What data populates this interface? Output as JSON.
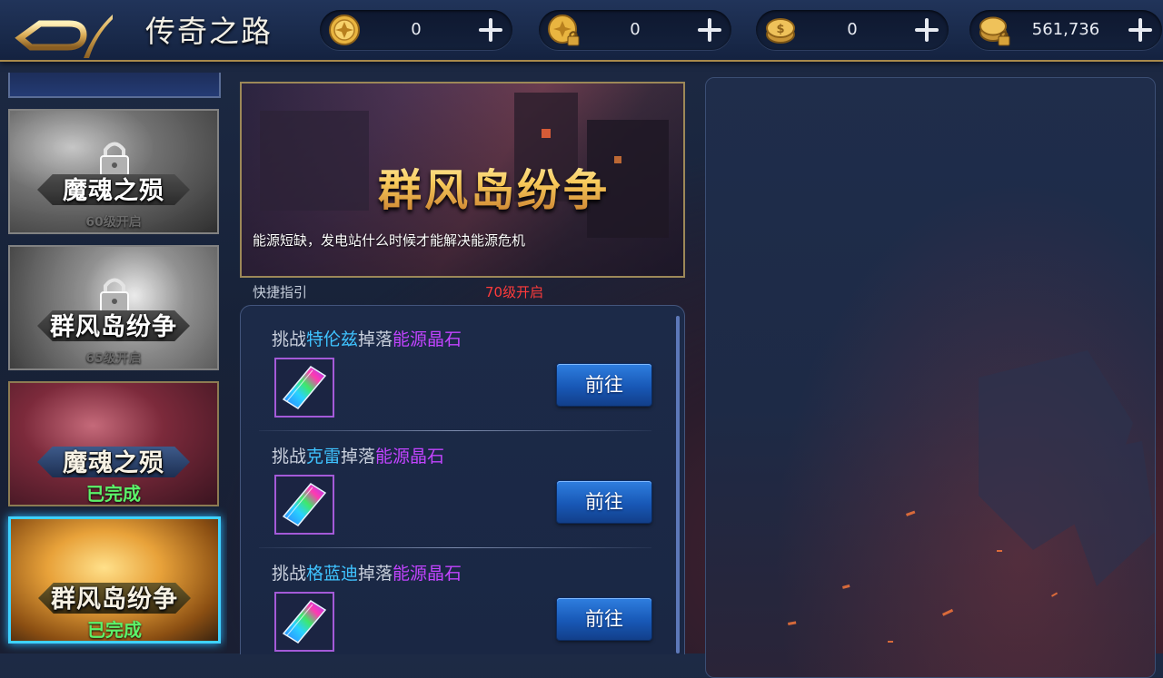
{
  "header": {
    "title": "传奇之路",
    "currencies": [
      {
        "icon": "gold-coin-icon",
        "amount": "0"
      },
      {
        "icon": "locked-gold-coin-icon",
        "amount": "0"
      },
      {
        "icon": "coin-stack-icon",
        "amount": "0"
      },
      {
        "icon": "locked-coin-stack-icon",
        "amount": "561,736"
      }
    ]
  },
  "chapters": [
    {
      "name": "魔魂之殒",
      "status": "60级开启",
      "locked": true,
      "selected": false
    },
    {
      "name": "群风岛纷争",
      "status": "65级开启",
      "locked": true,
      "selected": false
    },
    {
      "name": "魔魂之殒",
      "status": "已完成",
      "locked": false,
      "selected": false
    },
    {
      "name": "群风岛纷争",
      "status": "已完成",
      "locked": false,
      "selected": true
    }
  ],
  "detail": {
    "title": "群风岛纷争",
    "description": "能源短缺，发电站什么时候才能解决能源危机",
    "guide_label": "快捷指引",
    "unlock_level": "70级开启"
  },
  "tasks": [
    {
      "prefix": "挑战",
      "boss": "特伦兹",
      "middle": "掉落",
      "item": "能源晶石",
      "button": "前往"
    },
    {
      "prefix": "挑战",
      "boss": "克雷",
      "middle": "掉落",
      "item": "能源晶石",
      "button": "前往"
    },
    {
      "prefix": "挑战",
      "boss": "格蓝迪",
      "middle": "掉落",
      "item": "能源晶石",
      "button": "前往"
    }
  ],
  "colors": {
    "accent_gold": "#a88a4c",
    "boss_name": "#3fc3ff",
    "item_name": "#c244ff",
    "locked_text": "#ff3b3b",
    "completed_text": "#5cf26a",
    "selected_border": "#3fd2ff"
  }
}
